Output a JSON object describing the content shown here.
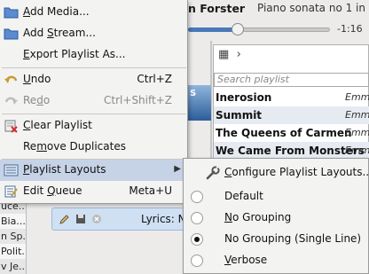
{
  "player": {
    "artist_partial": "n Forster",
    "track_partial": "Piano sonata no 1 in",
    "time_remaining": "-1:16",
    "progress": 0.35
  },
  "playlist": {
    "search_placeholder": "Search playlist",
    "rows": [
      {
        "title": "Inerosion",
        "artist_partial": "Emme"
      },
      {
        "title": "Summit",
        "artist_partial": "Emme"
      },
      {
        "title": "The Queens of Carmen",
        "artist_partial": "Emme"
      },
      {
        "title": "We Came From Monsters",
        "artist_partial": "Emme"
      }
    ],
    "art_text": "s S\\nO"
  },
  "left_list": [
    "uce...",
    "Bia...",
    "n Sp...",
    "Polit...",
    "v Je..."
  ],
  "lyrics": {
    "label": "Lyrics: N"
  },
  "menu": {
    "items": [
      {
        "label": "Add Media...",
        "shortcut": "",
        "icon": "folder-icon",
        "disabled": false
      },
      {
        "label": "Add Stream...",
        "shortcut": "",
        "icon": "folder-icon",
        "disabled": false
      },
      {
        "label": "Export Playlist As...",
        "shortcut": "",
        "icon": "",
        "disabled": false
      },
      {
        "label": "Undo",
        "shortcut": "Ctrl+Z",
        "icon": "undo-icon",
        "disabled": false
      },
      {
        "label": "Redo",
        "shortcut": "Ctrl+Shift+Z",
        "icon": "redo-icon",
        "disabled": true
      },
      {
        "label": "Clear Playlist",
        "shortcut": "",
        "icon": "clear-playlist-icon",
        "disabled": false
      },
      {
        "label": "Remove Duplicates",
        "shortcut": "",
        "icon": "",
        "disabled": false
      },
      {
        "label": "Playlist Layouts",
        "shortcut": "",
        "icon": "layouts-icon",
        "disabled": false
      },
      {
        "label": "Edit Queue",
        "shortcut": "Meta+U",
        "icon": "edit-queue-icon",
        "disabled": false
      }
    ]
  },
  "submenu": {
    "configure_label": "Configure Playlist Layouts...",
    "options": [
      {
        "label": "Default",
        "checked": false
      },
      {
        "label": "No Grouping",
        "checked": false
      },
      {
        "label": "No Grouping (Single Line)",
        "checked": true
      },
      {
        "label": "Verbose",
        "checked": false
      }
    ]
  },
  "colors": {
    "highlight": "#c6d3e6",
    "menu_bg": "#f3f3f2",
    "accent": "#4a79b8"
  }
}
